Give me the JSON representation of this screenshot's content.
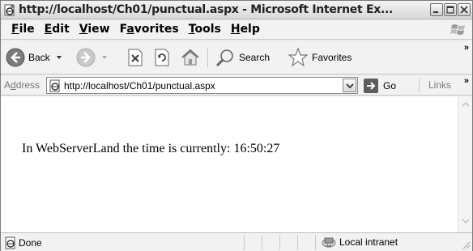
{
  "window": {
    "title": "http://localhost/Ch01/punctual.aspx - Microsoft Internet Ex...",
    "title_icon": "ie-page-icon",
    "buttons": [
      "minimize-icon",
      "maximize-icon",
      "close-icon"
    ]
  },
  "menu": {
    "items": [
      {
        "first": "F",
        "rest": "ile"
      },
      {
        "first": "E",
        "rest": "dit"
      },
      {
        "first": "V",
        "rest": "iew"
      },
      {
        "pre": "F",
        "first": "a",
        "rest": "vorites"
      },
      {
        "first": "T",
        "rest": "ools"
      },
      {
        "first": "H",
        "rest": "elp"
      }
    ]
  },
  "toolbar": {
    "back_label": "Back",
    "search_label": "Search",
    "favorites_label": "Favorites",
    "more": "»"
  },
  "address": {
    "label_first": "A",
    "label_ul": "d",
    "label_rest": "dress",
    "value": "http://localhost/Ch01/punctual.aspx",
    "go_label": "Go",
    "links_label": "Links",
    "links_more": "»"
  },
  "content": {
    "text": "In WebServerLand the time is currently: 16:50:27"
  },
  "status": {
    "text": "Done",
    "zone": "Local intranet"
  }
}
